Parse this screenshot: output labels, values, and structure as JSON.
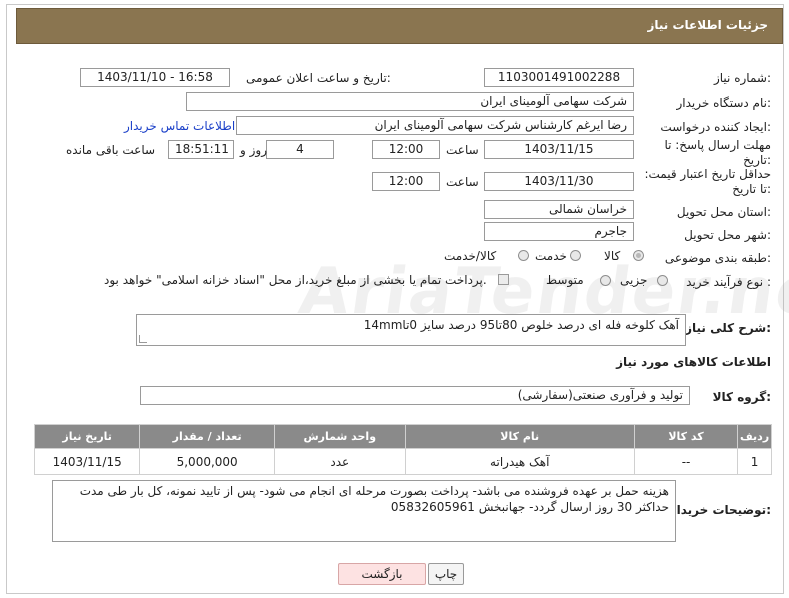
{
  "header": {
    "title": "جزئیات اطلاعات نیاز"
  },
  "fields": {
    "need_number_label": "شماره نیاز:",
    "need_number": "1103001491002288",
    "announce_label": "تاریخ و ساعت اعلان عمومی:",
    "announce_value": "1403/11/10 - 16:58",
    "buyer_label": "نام دستگاه خریدار:",
    "buyer_value": "شرکت سهامی آلومینای ایران",
    "creator_label": "ایجاد کننده درخواست:",
    "creator_value": "رضا ایرغم کارشناس شرکت سهامی آلومینای ایران",
    "contact_link": "اطلاعات تماس خریدار",
    "deadline_label": "مهلت ارسال پاسخ: تا تاریخ:",
    "deadline_date": "1403/11/15",
    "time_label": "ساعت",
    "deadline_time": "12:00",
    "days_value": "4",
    "days_label": "روز و",
    "remaining_time": "18:51:11",
    "remaining_label": "ساعت باقی مانده",
    "validity_label": "حداقل تاریخ اعتبار قیمت: تا تاریخ:",
    "validity_date": "1403/11/30",
    "validity_time": "12:00",
    "province_label": "استان محل تحویل:",
    "province_value": "خراسان شمالی",
    "city_label": "شهر محل تحویل:",
    "city_value": "جاجرم",
    "category_label": "طبقه بندی موضوعی:",
    "category_options": [
      "کالا",
      "خدمت",
      "کالا/خدمت"
    ],
    "process_label": "نوع فرآیند خرید :",
    "process_options": [
      "جزیی",
      "متوسط"
    ],
    "payment_note": "پرداخت تمام یا بخشی از مبلغ خرید،از محل \"اسناد خزانه اسلامی\" خواهد بود.",
    "description_label": "شرح کلی نیاز:",
    "description_value": "آهک کلوخه فله ای درصد خلوص 80تا95 درصد سایز 0تا14mm"
  },
  "goods_section": {
    "title": "اطلاعات کالاهای مورد نیاز",
    "group_label": "گروه کالا:",
    "group_value": "تولید و فرآوری صنعتی(سفارشی)"
  },
  "table": {
    "headers": [
      "ردیف",
      "کد کالا",
      "نام کالا",
      "واحد شمارش",
      "تعداد / مقدار",
      "تاریخ نیاز"
    ],
    "rows": [
      [
        "1",
        "--",
        "آهک هیدراته",
        "عدد",
        "5,000,000",
        "1403/11/15"
      ]
    ]
  },
  "notes": {
    "label": "توضیحات خریدار:",
    "value": "هزینه حمل بر عهده فروشنده می باشد- پرداخت بصورت مرحله ای انجام می شود- پس از تایید نمونه، کل بار طی مدت حداکثر 30 روز ارسال گردد- جهانبخش 05832605961"
  },
  "buttons": {
    "print": "چاپ",
    "back": "بازگشت"
  },
  "watermark": "AriaTender.net",
  "colors": {
    "header": "#8a7550",
    "table_header": "#8a8a8a"
  }
}
